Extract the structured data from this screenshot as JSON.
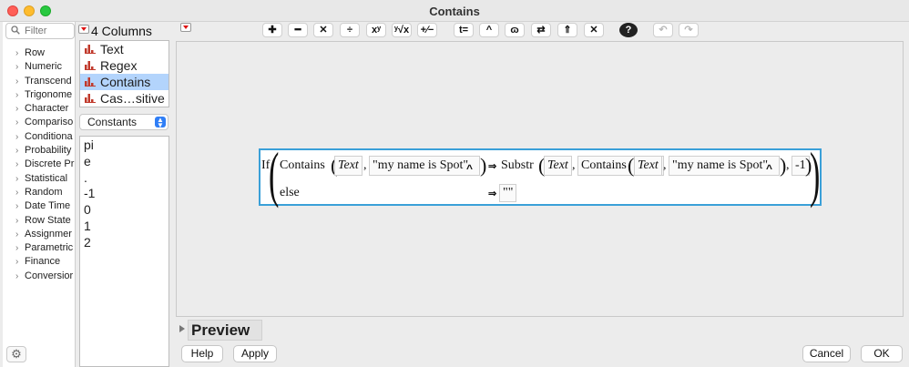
{
  "window": {
    "title": "Contains"
  },
  "functions": {
    "filter_placeholder": "Filter",
    "items": [
      {
        "label": "Row"
      },
      {
        "label": "Numeric"
      },
      {
        "label": "Transcend"
      },
      {
        "label": "Trigonome"
      },
      {
        "label": "Character"
      },
      {
        "label": "Compariso"
      },
      {
        "label": "Conditiona"
      },
      {
        "label": "Probability"
      },
      {
        "label": "Discrete Pr"
      },
      {
        "label": "Statistical"
      },
      {
        "label": "Random"
      },
      {
        "label": "Date Time"
      },
      {
        "label": "Row State"
      },
      {
        "label": "Assignmer"
      },
      {
        "label": "Parametric"
      },
      {
        "label": "Finance"
      },
      {
        "label": "Conversior"
      }
    ]
  },
  "columns": {
    "header": "4 Columns",
    "items": [
      {
        "label": "Text",
        "selected": false
      },
      {
        "label": "Regex",
        "selected": false
      },
      {
        "label": "Contains",
        "selected": true
      },
      {
        "label": "Cas…sitive",
        "selected": false
      }
    ],
    "icon": "column-icon",
    "icon_color": "#c0392b"
  },
  "constants": {
    "selected": "Constants",
    "items": [
      "pi",
      "e",
      ".",
      "-1",
      "0",
      "1",
      "2"
    ]
  },
  "toolbar": {
    "buttons": [
      {
        "name": "add-button",
        "label": "✚"
      },
      {
        "name": "subtract-button",
        "label": "━"
      },
      {
        "name": "multiply-button",
        "label": "✕"
      },
      {
        "name": "divide-button",
        "label": "÷"
      },
      {
        "name": "power-button",
        "label": "xʸ"
      },
      {
        "name": "root-button",
        "label": "ʸ√x"
      },
      {
        "name": "plusminus-button",
        "label": "+∕−"
      },
      {
        "name": "assign-button",
        "label": "t="
      },
      {
        "name": "peel-button",
        "label": "^"
      },
      {
        "name": "unary-button",
        "label": "ɷ"
      },
      {
        "name": "swap-button",
        "label": "⇄"
      },
      {
        "name": "push-button",
        "label": "⇑"
      },
      {
        "name": "delete-button",
        "label": "✕"
      },
      {
        "name": "help-button",
        "label": "?"
      },
      {
        "name": "undo-button",
        "label": "↶"
      },
      {
        "name": "redo-button",
        "label": "↷"
      }
    ]
  },
  "formula": {
    "if": "If",
    "contains": "Contains",
    "arg_col": "Text",
    "comma": ",",
    "string": "\"my name is Spot\"",
    "caret": "^",
    "arrow": "⇒",
    "substr": "Substr",
    "neg_one": "-1",
    "else": "else",
    "empty": "\"\""
  },
  "preview": {
    "label": "Preview"
  },
  "buttons": {
    "help": "Help",
    "apply": "Apply",
    "cancel": "Cancel",
    "ok": "OK"
  },
  "colors": {
    "selection": "#b3d4fc",
    "formula_border": "#3aa0d8"
  }
}
